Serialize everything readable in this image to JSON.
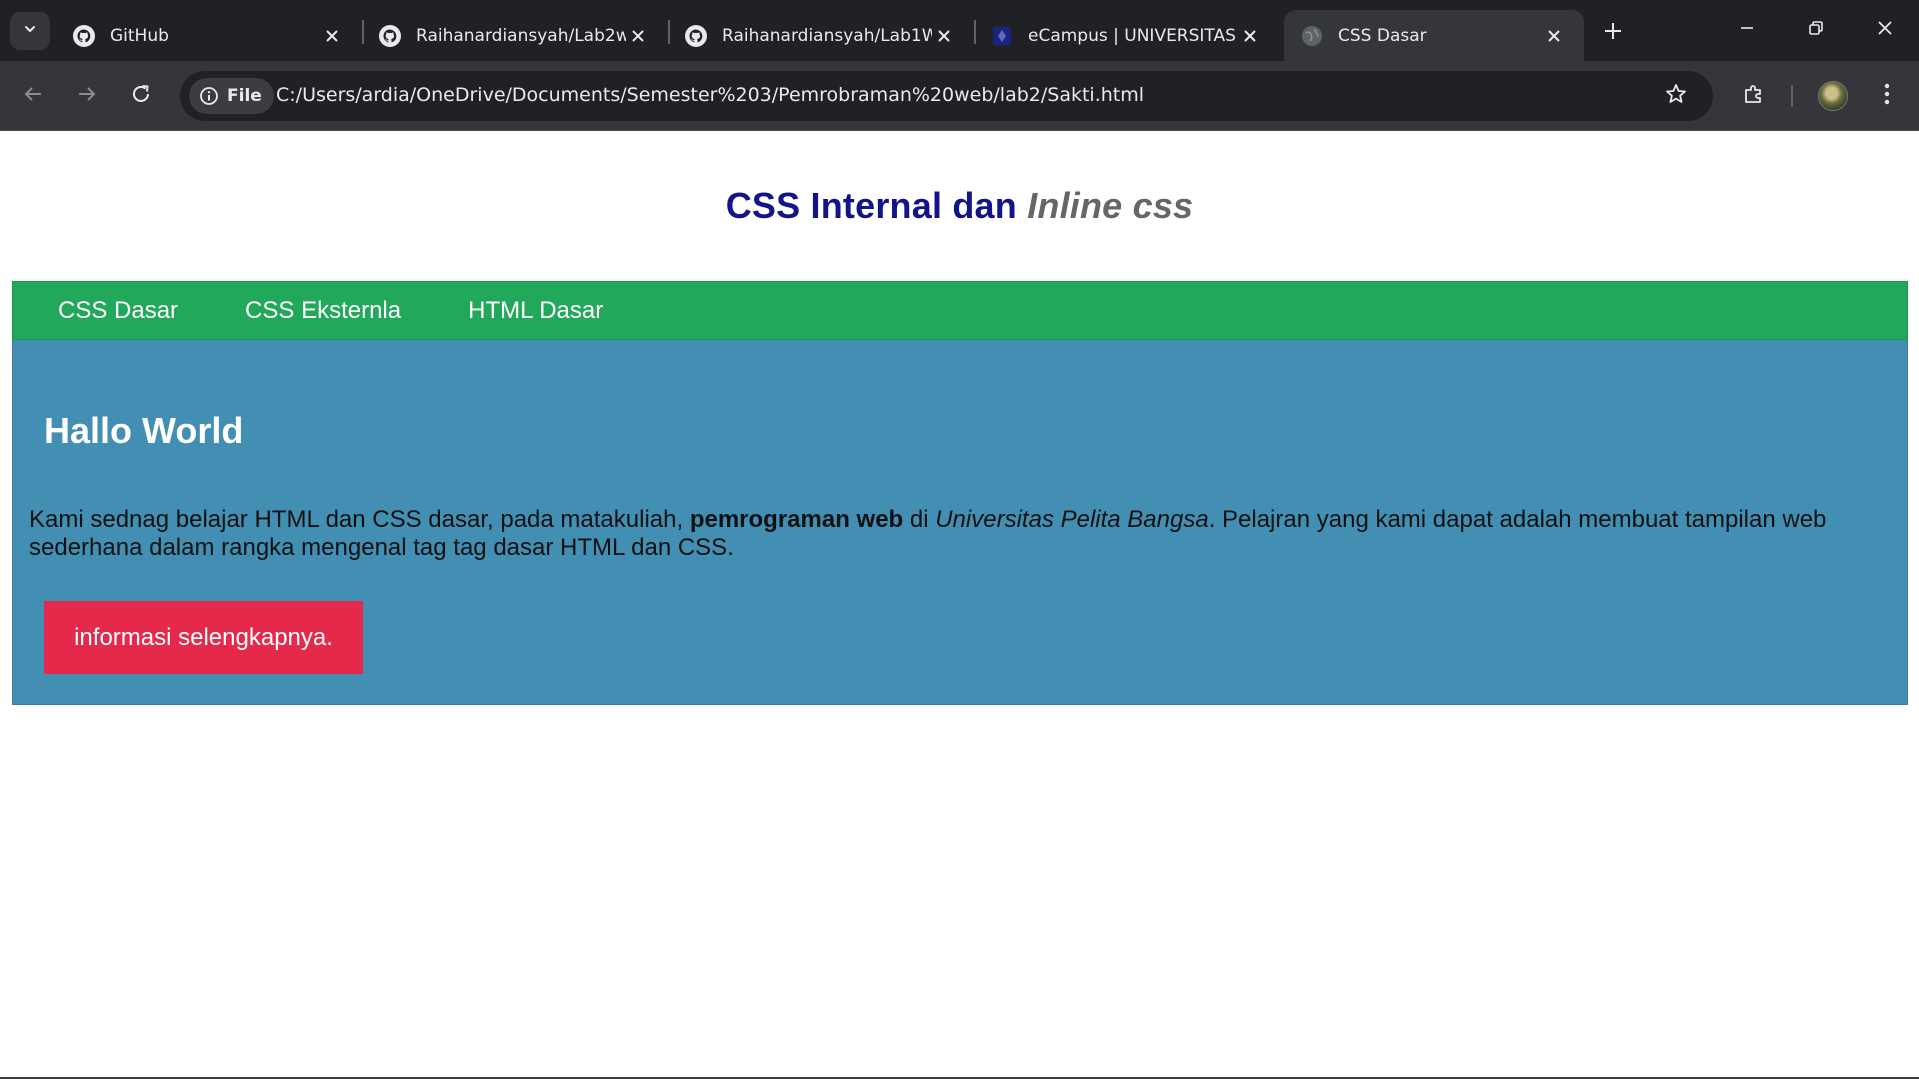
{
  "browser": {
    "tabs": [
      {
        "title": "GitHub",
        "icon": "github-icon",
        "active": false
      },
      {
        "title": "Raihanardiansyah/Lab2w",
        "icon": "github-icon",
        "active": false
      },
      {
        "title": "Raihanardiansyah/Lab1W",
        "icon": "github-icon",
        "active": false
      },
      {
        "title": "eCampus | UNIVERSITAS",
        "icon": "ecampus-icon",
        "active": false
      },
      {
        "title": "CSS Dasar",
        "icon": "globe-icon",
        "active": true
      }
    ],
    "address": {
      "chip_label": "File",
      "url": "C:/Users/ardia/OneDrive/Documents/Semester%203/Pemrobraman%20web/lab2/Sakti.html"
    },
    "colors": {
      "chrome_dark": "#202124",
      "chrome_toolbar": "#35363a"
    }
  },
  "page": {
    "header": {
      "title_main": "CSS Internal dan ",
      "title_italic": "Inline css"
    },
    "nav": [
      "CSS Dasar",
      "CSS Eksternla",
      "HTML Dasar"
    ],
    "hero": {
      "heading": "Hallo World",
      "paragraph": {
        "part1": "Kami sednag belajar HTML dan CSS dasar, pada matakuliah, ",
        "bold": "pemrograman web",
        "part2": " di ",
        "italic": "Universitas Pelita Bangsa",
        "part3": ". Pelajran yang kami dapat adalah membuat tampilan web sederhana dalam rangka mengenal tag tag dasar HTML dan CSS."
      },
      "button_label": "informasi selengkapnya."
    },
    "colors": {
      "title": "#14148a",
      "title_italic": "#666666",
      "nav_bg": "#22a85a",
      "hero_bg": "#428fb3",
      "button_bg": "#e5294a"
    }
  }
}
